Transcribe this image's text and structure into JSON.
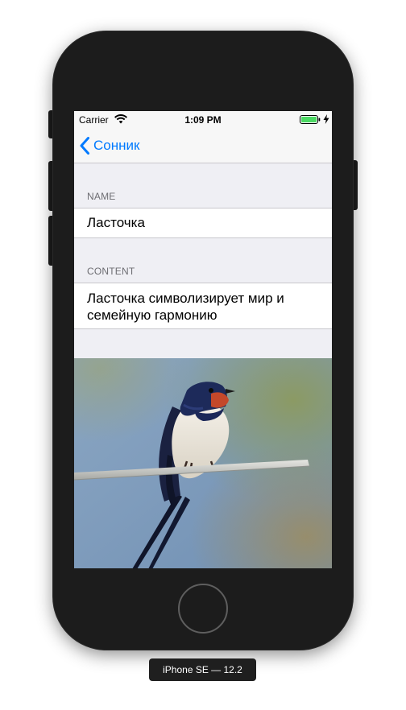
{
  "status_bar": {
    "carrier": "Carrier",
    "time": "1:09 PM",
    "battery_color": "#4cd964"
  },
  "nav": {
    "back_label": "Сонник",
    "tint_color": "#007aff"
  },
  "form": {
    "name_header": "NAME",
    "name_value": "Ласточка",
    "content_header": "CONTENT",
    "content_value": "Ласточка символизирует мир и семейную гармонию"
  },
  "image": {
    "subject": "swallow-on-wire-photo"
  },
  "device": {
    "label": "iPhone SE — 12.2"
  },
  "icons": [
    "wifi-icon",
    "battery-icon",
    "charging-icon",
    "chevron-left-icon",
    "home-button"
  ]
}
